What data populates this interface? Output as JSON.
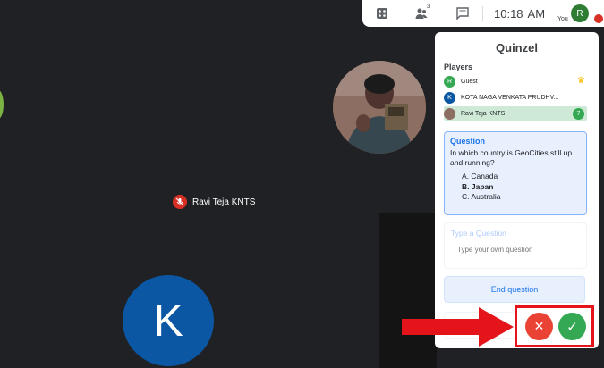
{
  "topbar": {
    "people_count": "3",
    "time": "10:18",
    "ampm": "AM",
    "you_label": "You",
    "user_initial": "R",
    "icons": [
      "dice-icon",
      "people-icon",
      "chat-icon",
      "mic-off-icon"
    ]
  },
  "stage": {
    "speaker_name": "Ravi Teja KNTS",
    "big_avatar_initial": "K"
  },
  "quinzel": {
    "title": "Quinzel",
    "players_label": "Players",
    "players": [
      {
        "initial": "R",
        "name": "Guest",
        "color": "#34a853",
        "badge": "crown"
      },
      {
        "initial": "K",
        "name": "KOTA NAGA VENKATA PRUDHV...",
        "color": "#0b57a4"
      },
      {
        "initial": "",
        "name": "Ravi Teja KNTS",
        "color": "#8d6e63",
        "score": "7"
      }
    ],
    "question": {
      "label": "Question",
      "text": "In which country is GeoCities still up and running?",
      "options": [
        {
          "letter": "A.",
          "text": "Canada",
          "bold": false
        },
        {
          "letter": "B.",
          "text": "Japan",
          "bold": true
        },
        {
          "letter": "C.",
          "text": "Australia",
          "bold": false
        }
      ]
    },
    "type_question": {
      "label": "Type a Question",
      "placeholder": "Type your own question"
    },
    "end_button": "End question",
    "wrong_button": "✕",
    "right_button": "✓"
  },
  "colors": {
    "highlight": "#e5141b",
    "wrong": "#ea4335",
    "right": "#34a853",
    "accent": "#1a73e8"
  }
}
